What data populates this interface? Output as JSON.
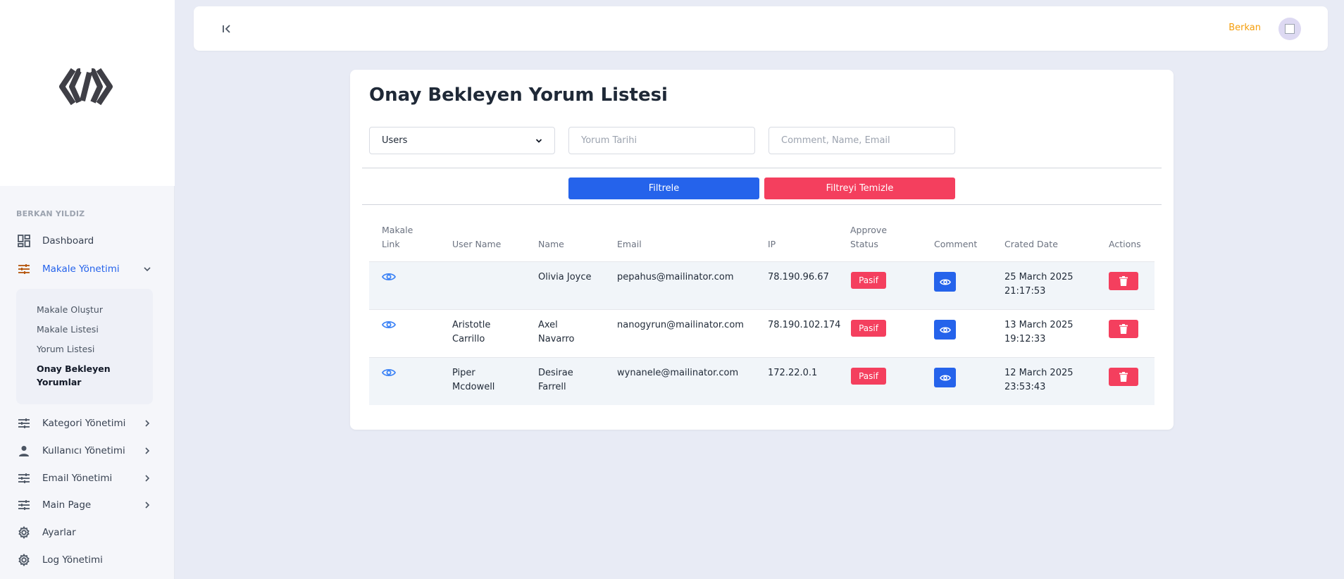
{
  "sidebar": {
    "user_heading": "BERKAN YILDIZ",
    "items": [
      {
        "label": "Dashboard",
        "icon": "dashboard-icon"
      },
      {
        "label": "Makale Yönetimi",
        "icon": "sliders-icon",
        "active": true
      },
      {
        "label": "Kategori Yönetimi",
        "icon": "sliders-icon"
      },
      {
        "label": "Kullanıcı Yönetimi",
        "icon": "person-icon"
      },
      {
        "label": "Email Yönetimi",
        "icon": "sliders-icon"
      },
      {
        "label": "Main Page",
        "icon": "sliders-icon"
      },
      {
        "label": "Ayarlar",
        "icon": "gear-icon"
      },
      {
        "label": "Log Yönetimi",
        "icon": "gear-icon"
      }
    ],
    "submenu": [
      {
        "label": "Makale Oluştur"
      },
      {
        "label": "Makale Listesi"
      },
      {
        "label": "Yorum Listesi"
      },
      {
        "label": "Onay Bekleyen Yorumlar",
        "active": true
      }
    ]
  },
  "topbar": {
    "username": "Berkan"
  },
  "page": {
    "title": "Onay Bekleyen Yorum Listesi",
    "filters": {
      "user_select": "Users",
      "date_placeholder": "Yorum Tarihi",
      "search_placeholder": "Comment, Name, Email"
    },
    "filter_button": "Filtrele",
    "clear_button": "Filtreyi Temizle"
  },
  "table": {
    "headers": [
      "Makale Link",
      "User Name",
      "Name",
      "Email",
      "IP",
      "Approve Status",
      "Comment",
      "Crated Date",
      "Actions"
    ],
    "rows": [
      {
        "user_name": "",
        "name": "Olivia Joyce",
        "email": "pepahus@mailinator.com",
        "ip": "78.190.96.67",
        "status": "Pasif",
        "date": "25 March 2025 21:17:53"
      },
      {
        "user_name": "Aristotle Carrillo",
        "name": "Axel Navarro",
        "email": "nanogyrun@mailinator.com",
        "ip": "78.190.102.174",
        "status": "Pasif",
        "date": "13 March 2025 19:12:33"
      },
      {
        "user_name": "Piper Mcdowell",
        "name": "Desirae Farrell",
        "email": "wynanele@mailinator.com",
        "ip": "172.22.0.1",
        "status": "Pasif",
        "date": "12 March 2025 23:53:43"
      }
    ]
  },
  "colors": {
    "accent": "#2563eb",
    "danger": "#f43f5e",
    "user": "#f59e0b",
    "background": "#e8ebf5"
  }
}
